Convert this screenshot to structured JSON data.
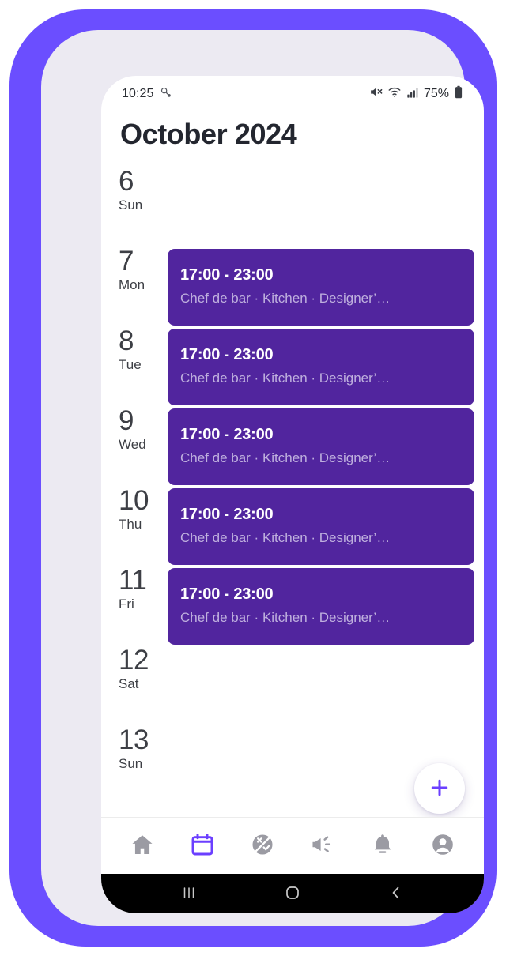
{
  "status_bar": {
    "time": "10:25",
    "left_icon": "location-pin-icon",
    "icons": [
      "mute-icon",
      "wifi-icon",
      "signal-bars-icon"
    ],
    "battery_percent": "75%",
    "battery_icon": "battery-icon"
  },
  "header": {
    "title": "October 2024"
  },
  "agenda": {
    "rows": [
      {
        "day": "6",
        "dow": "Sun",
        "has_event": false,
        "event": {
          "time": "",
          "subtitle": ""
        }
      },
      {
        "day": "7",
        "dow": "Mon",
        "has_event": true,
        "event": {
          "time": "17:00 - 23:00",
          "subtitle": "Chef de bar · Kitchen  · Designer’…"
        }
      },
      {
        "day": "8",
        "dow": "Tue",
        "has_event": true,
        "event": {
          "time": "17:00 - 23:00",
          "subtitle": "Chef de bar · Kitchen  · Designer’…"
        }
      },
      {
        "day": "9",
        "dow": "Wed",
        "has_event": true,
        "event": {
          "time": "17:00 - 23:00",
          "subtitle": "Chef de bar · Kitchen  · Designer’…"
        }
      },
      {
        "day": "10",
        "dow": "Thu",
        "has_event": true,
        "event": {
          "time": "17:00 - 23:00",
          "subtitle": "Chef de bar · Kitchen  · Designer’…"
        }
      },
      {
        "day": "11",
        "dow": "Fri",
        "has_event": true,
        "event": {
          "time": "17:00 - 23:00",
          "subtitle": "Chef de bar · Kitchen  · Designer’…"
        }
      },
      {
        "day": "12",
        "dow": "Sat",
        "has_event": false,
        "event": {
          "time": "",
          "subtitle": ""
        }
      },
      {
        "day": "13",
        "dow": "Sun",
        "has_event": false,
        "event": {
          "time": "",
          "subtitle": ""
        }
      }
    ]
  },
  "fab": {
    "icon": "plus-icon",
    "label": "+"
  },
  "bottom_nav": {
    "items": [
      {
        "icon": "home-icon",
        "active": false
      },
      {
        "icon": "calendar-icon",
        "active": true
      },
      {
        "icon": "availability-icon",
        "active": false
      },
      {
        "icon": "megaphone-icon",
        "active": false
      },
      {
        "icon": "bell-icon",
        "active": false
      },
      {
        "icon": "account-icon",
        "active": false
      }
    ]
  },
  "system_nav": {
    "items": [
      {
        "icon": "recents-icon"
      },
      {
        "icon": "home-circle-icon"
      },
      {
        "icon": "back-icon"
      }
    ]
  },
  "colors": {
    "frame_purple": "#6B4EFF",
    "bezel": "#ECEAF2",
    "event_card": "#51259E",
    "event_subtitle": "#BFB0DE",
    "accent": "#6B3FFF",
    "nav_inactive": "#9b9ba3",
    "title": "#23262F"
  }
}
